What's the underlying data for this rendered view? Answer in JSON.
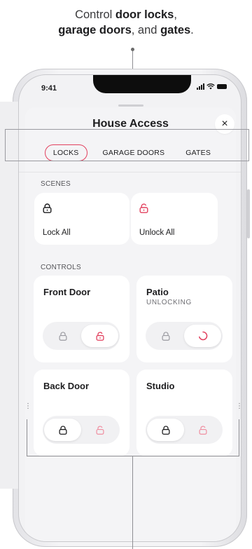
{
  "caption": {
    "line1_prefix": "Control ",
    "line1_bold": "door locks",
    "line1_suffix": ",",
    "line2_bold1": "garage doors",
    "line2_mid": ", and ",
    "line2_bold2": "gates",
    "line2_end": "."
  },
  "status_bar": {
    "time": "9:41"
  },
  "sheet": {
    "title": "House Access",
    "close_label": "×"
  },
  "tabs": [
    {
      "label": "LOCKS",
      "active": true
    },
    {
      "label": "GARAGE DOORS",
      "active": false
    },
    {
      "label": "GATES",
      "active": false
    }
  ],
  "scenes": {
    "label": "SCENES",
    "items": [
      {
        "label": "Lock All",
        "icon": "lock-closed-icon",
        "color": "#1d1d1f"
      },
      {
        "label": "Unlock All",
        "icon": "lock-open-icon",
        "color": "#e2405e"
      }
    ]
  },
  "controls": {
    "label": "CONTROLS",
    "items": [
      {
        "name": "Front Door",
        "status": "",
        "active": "unlock"
      },
      {
        "name": "Patio",
        "status": "UNLOCKING",
        "active": "unlocking"
      },
      {
        "name": "Back Door",
        "status": "",
        "active": "lock"
      },
      {
        "name": "Studio",
        "status": "",
        "active": "lock"
      }
    ]
  },
  "colors": {
    "accent": "#e2405e",
    "text": "#1d1d1f",
    "muted": "#9a9aa0"
  }
}
